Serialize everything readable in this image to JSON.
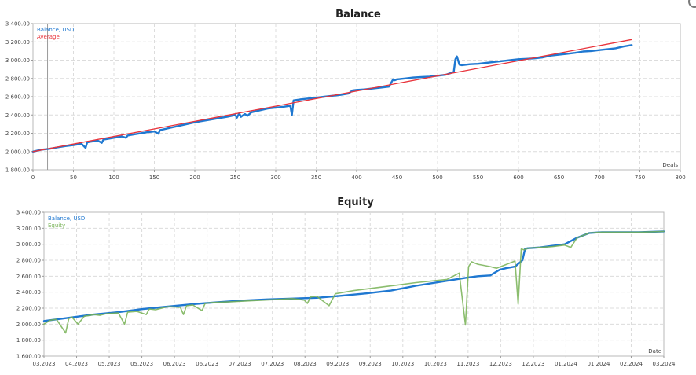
{
  "chart_data": [
    {
      "type": "line",
      "title": "Balance",
      "xlabel": "Deals",
      "ylabel": "",
      "xlim": [
        0,
        800
      ],
      "ylim": [
        1800,
        3400
      ],
      "x_ticks": [
        "0",
        "50",
        "100",
        "150",
        "200",
        "250",
        "300",
        "350",
        "400",
        "450",
        "500",
        "550",
        "600",
        "650",
        "700",
        "750",
        "800"
      ],
      "y_ticks": [
        "1 800.00",
        "2 000.00",
        "2 200.00",
        "2 400.00",
        "2 600.00",
        "2 800.00",
        "3 000.00",
        "3 200.00",
        "3 400.00"
      ],
      "grid": true,
      "legend_position": "top-left",
      "marker_x": 18,
      "series": [
        {
          "name": "Balance, USD",
          "color": "#1f78d1",
          "x": [
            0,
            10,
            20,
            30,
            40,
            50,
            60,
            65,
            67,
            70,
            80,
            85,
            87,
            90,
            100,
            110,
            115,
            117,
            120,
            130,
            140,
            150,
            155,
            157,
            160,
            170,
            180,
            200,
            220,
            240,
            250,
            252,
            255,
            257,
            260,
            262,
            265,
            270,
            280,
            290,
            300,
            310,
            318,
            320,
            322,
            330,
            340,
            350,
            360,
            370,
            380,
            390,
            395,
            400,
            410,
            420,
            430,
            440,
            445,
            447,
            450,
            460,
            470,
            480,
            490,
            500,
            510,
            520,
            522,
            524,
            527,
            530,
            540,
            550,
            560,
            570,
            580,
            590,
            600,
            610,
            620,
            630,
            640,
            650,
            660,
            670,
            680,
            690,
            700,
            710,
            720,
            730,
            740
          ],
          "y": [
            2000,
            2020,
            2030,
            2045,
            2060,
            2070,
            2085,
            2040,
            2100,
            2105,
            2120,
            2095,
            2130,
            2135,
            2150,
            2165,
            2150,
            2175,
            2180,
            2195,
            2210,
            2220,
            2195,
            2235,
            2240,
            2260,
            2280,
            2320,
            2350,
            2380,
            2400,
            2370,
            2420,
            2380,
            2400,
            2410,
            2390,
            2430,
            2450,
            2470,
            2480,
            2490,
            2500,
            2400,
            2560,
            2570,
            2580,
            2590,
            2600,
            2610,
            2620,
            2635,
            2670,
            2675,
            2680,
            2690,
            2700,
            2710,
            2790,
            2780,
            2790,
            2800,
            2810,
            2815,
            2820,
            2830,
            2840,
            2870,
            3010,
            3040,
            2950,
            2945,
            2955,
            2960,
            2970,
            2980,
            2990,
            3000,
            3010,
            3015,
            3020,
            3030,
            3050,
            3060,
            3070,
            3080,
            3095,
            3100,
            3110,
            3120,
            3130,
            3150,
            3165
          ]
        },
        {
          "name": "Average",
          "color": "#e8333b",
          "x": [
            0,
            740
          ],
          "y": [
            2000,
            3225
          ]
        }
      ]
    },
    {
      "type": "line",
      "title": "Equity",
      "xlabel": "Date",
      "ylabel": "",
      "xlim": [
        0,
        1
      ],
      "ylim": [
        1600,
        3400
      ],
      "x_ticks": [
        "03.2023",
        "04.2023",
        "05.2023",
        "05.2023",
        "06.2023",
        "06.2023",
        "07.2023",
        "07.2023",
        "08.2023",
        "09.2023",
        "09.2023",
        "10.2023",
        "10.2023",
        "11.2023",
        "12.2023",
        "12.2023",
        "01.2024",
        "01.2024",
        "02.2024",
        "03.2024"
      ],
      "y_ticks": [
        "1 600.00",
        "1 800.00",
        "2 000.00",
        "2 200.00",
        "2 400.00",
        "2 600.00",
        "2 800.00",
        "3 000.00",
        "3 200.00",
        "3 400.00"
      ],
      "grid": true,
      "legend_position": "top-left",
      "series": [
        {
          "name": "Balance, USD",
          "color": "#1f78d1",
          "x": [
            0,
            0.04,
            0.08,
            0.12,
            0.16,
            0.2,
            0.24,
            0.28,
            0.32,
            0.36,
            0.4,
            0.44,
            0.48,
            0.52,
            0.56,
            0.6,
            0.64,
            0.68,
            0.7,
            0.72,
            0.735,
            0.745,
            0.76,
            0.772,
            0.776,
            0.78,
            0.8,
            0.82,
            0.84,
            0.86,
            0.88,
            0.9,
            0.92,
            0.94,
            0.96,
            0.98,
            1.0
          ],
          "y": [
            2040,
            2080,
            2120,
            2150,
            2190,
            2220,
            2250,
            2275,
            2295,
            2310,
            2320,
            2330,
            2355,
            2385,
            2420,
            2480,
            2530,
            2580,
            2600,
            2610,
            2680,
            2700,
            2720,
            2800,
            2940,
            2950,
            2960,
            2980,
            3000,
            3080,
            3140,
            3150,
            3150,
            3150,
            3150,
            3155,
            3160
          ]
        },
        {
          "name": "Equity",
          "color": "#77b255",
          "x": [
            0,
            0.01,
            0.02,
            0.035,
            0.04,
            0.045,
            0.055,
            0.065,
            0.075,
            0.08,
            0.09,
            0.1,
            0.12,
            0.13,
            0.135,
            0.15,
            0.165,
            0.17,
            0.18,
            0.2,
            0.22,
            0.225,
            0.23,
            0.24,
            0.255,
            0.26,
            0.27,
            0.3,
            0.34,
            0.38,
            0.4,
            0.42,
            0.425,
            0.43,
            0.44,
            0.46,
            0.47,
            0.5,
            0.55,
            0.6,
            0.65,
            0.67,
            0.68,
            0.685,
            0.69,
            0.7,
            0.72,
            0.73,
            0.74,
            0.76,
            0.765,
            0.77,
            0.775,
            0.78,
            0.8,
            0.82,
            0.84,
            0.85,
            0.86,
            0.88,
            0.9,
            0.92,
            0.94,
            0.96,
            0.98,
            1.0
          ],
          "y": [
            2000,
            2050,
            2060,
            1890,
            2070,
            2090,
            2000,
            2100,
            2110,
            2120,
            2110,
            2130,
            2140,
            2000,
            2150,
            2160,
            2120,
            2190,
            2180,
            2220,
            2210,
            2120,
            2230,
            2240,
            2170,
            2260,
            2270,
            2280,
            2295,
            2310,
            2320,
            2300,
            2260,
            2340,
            2350,
            2230,
            2380,
            2420,
            2470,
            2520,
            2560,
            2640,
            1990,
            2720,
            2780,
            2750,
            2720,
            2700,
            2730,
            2790,
            2250,
            2940,
            2930,
            2950,
            2960,
            2970,
            2990,
            2960,
            3080,
            3140,
            3150,
            3150,
            3150,
            3150,
            3155,
            3160
          ]
        }
      ]
    }
  ]
}
